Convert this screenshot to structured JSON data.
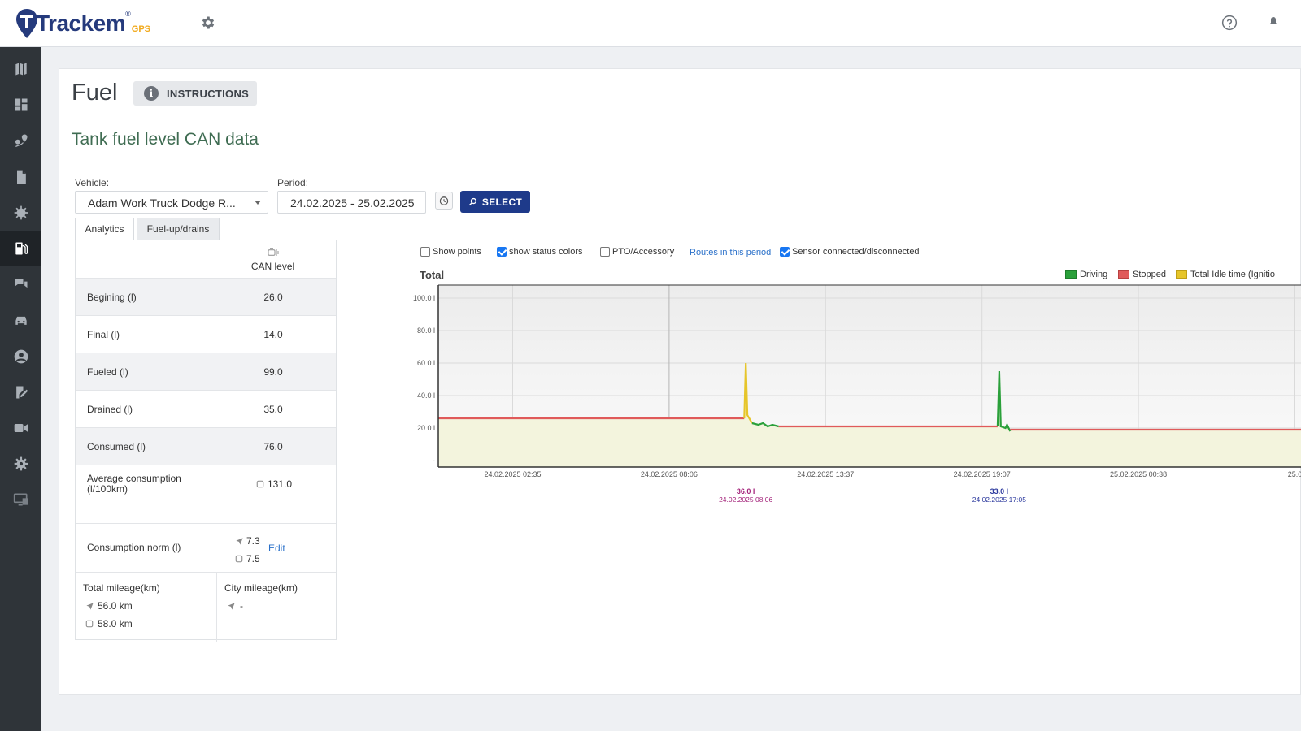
{
  "brand": {
    "name": "Trackem",
    "suffix": "GPS",
    "reg": "®"
  },
  "icons": {
    "top_gear": "gear-icon",
    "help": "help-circle-icon",
    "bell": "bell-icon",
    "sidebar": [
      "map-icon",
      "dashboard-icon",
      "route-pin-icon",
      "document-icon",
      "virus-icon",
      "fuel-icon",
      "chat-icon",
      "car-icon",
      "user-icon",
      "edit-note-icon",
      "video-icon",
      "gear-icon",
      "screen-icon"
    ]
  },
  "page": {
    "title": "Fuel",
    "instructions_label": "INSTRUCTIONS",
    "section_title": "Tank fuel level CAN data"
  },
  "filters": {
    "vehicle_label": "Vehicle:",
    "vehicle_value": "Adam Work Truck Dodge R...",
    "period_label": "Period:",
    "period_value": "24.02.2025 - 25.02.2025",
    "select_label": "SELECT"
  },
  "tabs": [
    "Analytics",
    "Fuel-up/drains"
  ],
  "table": {
    "column": "CAN level",
    "rows": [
      {
        "label": "Begining (l)",
        "value": "26.0"
      },
      {
        "label": "Final (l)",
        "value": "14.0"
      },
      {
        "label": "Fueled (l)",
        "value": "99.0"
      },
      {
        "label": "Drained (l)",
        "value": "35.0"
      },
      {
        "label": "Consumed (l)",
        "value": "76.0"
      }
    ],
    "avg_label": "Average consumption (l/100km)",
    "avg_value": "131.0",
    "norm_label": "Consumption norm (l)",
    "norm_gps": "7.3",
    "norm_can": "7.5",
    "edit_label": "Edit",
    "total_mileage_label": "Total mileage(km)",
    "total_mileage_gps": "56.0 km",
    "total_mileage_can": "58.0 km",
    "city_mileage_label": "City mileage(km)",
    "city_mileage_gps": "-"
  },
  "chart_controls": {
    "show_points": {
      "label": "Show points",
      "checked": false
    },
    "status_colors": {
      "label": "show status colors",
      "checked": true
    },
    "pto": {
      "label": "PTO/Accessory",
      "checked": false
    },
    "routes_link": "Routes in this period",
    "sensor": {
      "label": "Sensor connected/disconnected",
      "checked": true
    }
  },
  "chart_data": {
    "type": "line",
    "title": "Total",
    "y_ticks": [
      "100.0 l",
      "80.0 l",
      "60.0 l",
      "40.0 l",
      "20.0 l",
      "-"
    ],
    "ylim": [
      0,
      100
    ],
    "x_ticks": [
      "24.02.2025 02:35",
      "24.02.2025 08:06",
      "24.02.2025 13:37",
      "24.02.2025 19:07",
      "25.02.2025 00:38",
      "25.0"
    ],
    "legend": [
      {
        "name": "Driving",
        "color": "#2aa03a"
      },
      {
        "name": "Stopped",
        "color": "#e05a5a"
      },
      {
        "name": "Total Idle time (Ignitio",
        "color": "#e6c52a"
      }
    ],
    "grid": true,
    "series": [
      {
        "status": "stopped",
        "points": [
          [
            0,
            26
          ],
          [
            1.48,
            26
          ]
        ]
      },
      {
        "status": "idle",
        "points": [
          [
            1.48,
            26
          ],
          [
            1.49,
            60
          ],
          [
            1.5,
            28
          ],
          [
            1.53,
            23
          ]
        ]
      },
      {
        "status": "driving",
        "points": [
          [
            1.53,
            23
          ],
          [
            1.57,
            22
          ],
          [
            1.6,
            23
          ],
          [
            1.63,
            21
          ],
          [
            1.66,
            22
          ],
          [
            1.7,
            21
          ]
        ]
      },
      {
        "status": "stopped",
        "points": [
          [
            1.7,
            21
          ],
          [
            3.1,
            21
          ]
        ]
      },
      {
        "status": "driving",
        "points": [
          [
            3.1,
            21
          ],
          [
            3.11,
            55
          ],
          [
            3.12,
            21
          ],
          [
            3.15,
            20
          ],
          [
            3.16,
            22
          ],
          [
            3.18,
            18
          ]
        ]
      },
      {
        "status": "stopped",
        "points": [
          [
            3.18,
            19
          ],
          [
            5.25,
            19
          ]
        ]
      }
    ],
    "markers": [
      {
        "x": 1.49,
        "value": "36.0 l",
        "time": "24.02.2025 08:06",
        "color": "#a3227a"
      },
      {
        "x": 3.11,
        "value": "33.0 l",
        "time": "24.02.2025 17:05",
        "color": "#2d3a9e"
      }
    ]
  }
}
